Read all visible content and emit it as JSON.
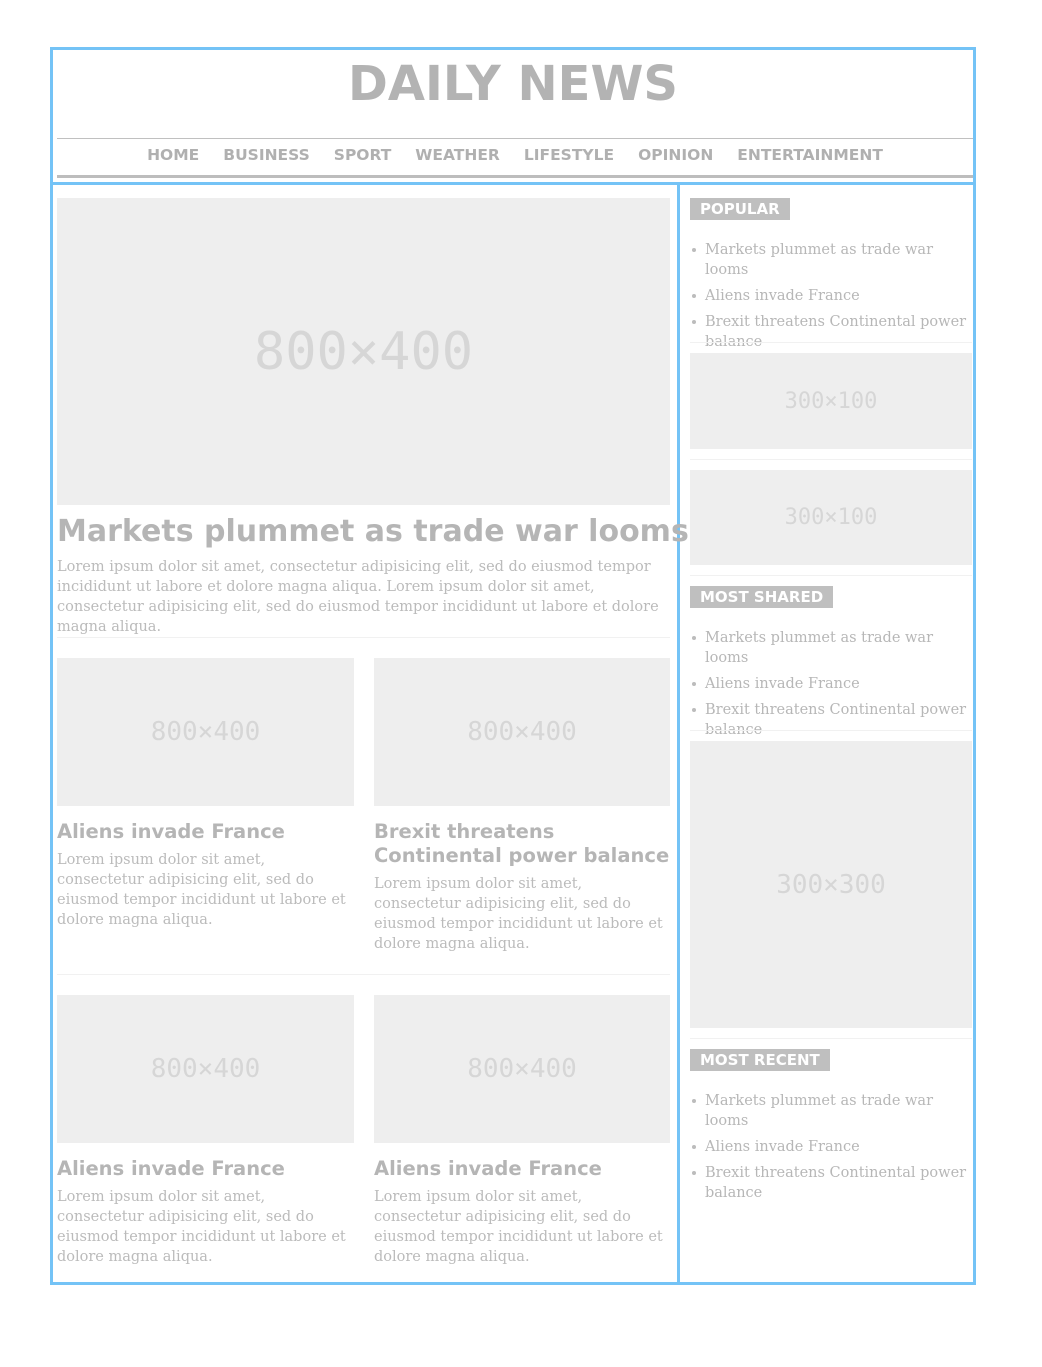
{
  "site": {
    "title": "DAILY NEWS"
  },
  "nav": {
    "items": [
      "HOME",
      "BUSINESS",
      "SPORT",
      "WEATHER",
      "LIFESTYLE",
      "OPINION",
      "ENTERTAINMENT"
    ]
  },
  "lead_story": {
    "image_label": "800×400",
    "headline": "Markets plummet as trade war looms",
    "body": "Lorem ipsum dolor sit amet, consectetur adipisicing elit, sed do eiusmod tempor incididunt ut labore et dolore magna aliqua. Lorem ipsum dolor sit amet, consectetur adipisicing elit, sed do eiusmod tempor incididunt ut labore et dolore magna aliqua."
  },
  "stories": [
    {
      "image_label": "800×400",
      "headline": "Aliens invade France",
      "body": "Lorem ipsum dolor sit amet, consectetur adipisicing elit, sed do eiusmod tempor incididunt ut labore et dolore magna aliqua."
    },
    {
      "image_label": "800×400",
      "headline": "Brexit threatens Continental power balance",
      "body": "Lorem ipsum dolor sit amet, consectetur adipisicing elit, sed do eiusmod tempor incididunt ut labore et dolore magna aliqua."
    },
    {
      "image_label": "800×400",
      "headline": "Aliens invade France",
      "body": "Lorem ipsum dolor sit amet, consectetur adipisicing elit, sed do eiusmod tempor incididunt ut labore et dolore magna aliqua."
    },
    {
      "image_label": "800×400",
      "headline": "Aliens invade France",
      "body": "Lorem ipsum dolor sit amet, consectetur adipisicing elit, sed do eiusmod tempor incididunt ut labore et dolore magna aliqua."
    }
  ],
  "sidebar": {
    "popular": {
      "title": "POPULAR",
      "items": [
        "Markets plummet as trade war looms",
        "Aliens invade France",
        "Brexit threatens Continental power balance"
      ]
    },
    "ad1": {
      "label": "300×100"
    },
    "ad2": {
      "label": "300×100"
    },
    "most_shared": {
      "title": "MOST SHARED",
      "items": [
        "Markets plummet as trade war looms",
        "Aliens invade France",
        "Brexit threatens Continental power balance"
      ]
    },
    "ad3": {
      "label": "300×300"
    },
    "most_recent": {
      "title": "MOST RECENT",
      "items": [
        "Markets plummet as trade war looms",
        "Aliens invade France",
        "Brexit threatens Continental power balance"
      ]
    }
  },
  "colors": {
    "frame": "#74c3f6",
    "placeholder": "#eeeeee",
    "text": "#b8b8b8",
    "badge": "#bfbfbf"
  }
}
